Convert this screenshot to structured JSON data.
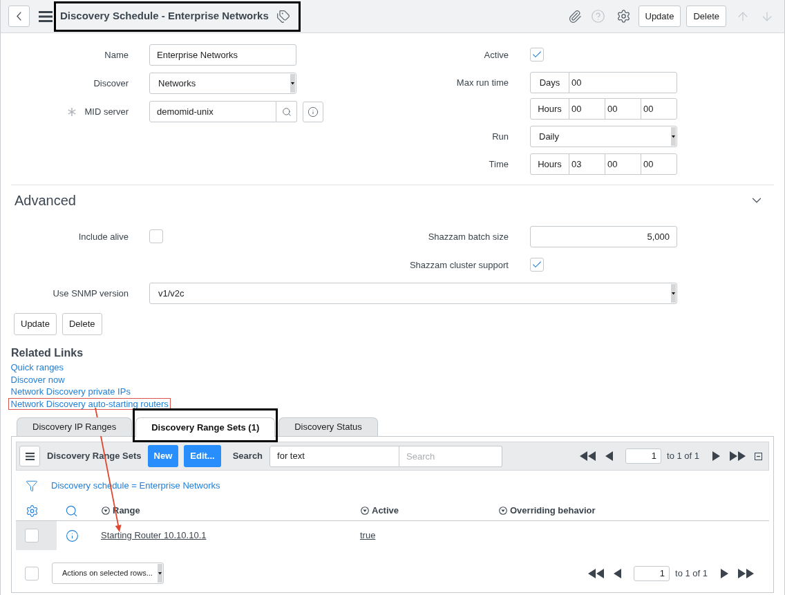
{
  "header": {
    "title": "Discovery Schedule - Enterprise Networks",
    "title_highlighted": true,
    "buttons": [
      "Update",
      "Delete"
    ],
    "nav": [
      {
        "kind": "up",
        "disabled": true
      },
      {
        "kind": "down",
        "disabled": true
      }
    ]
  },
  "form": {
    "left": [
      {
        "kind": "text",
        "label": "Name",
        "value": "Enterprise Networks",
        "required": false
      },
      {
        "kind": "select",
        "label": "Discover",
        "value": "Networks",
        "required": false
      },
      {
        "kind": "reference",
        "label": "MID server",
        "value": "demomid-unix",
        "required": true
      }
    ],
    "right": [
      {
        "kind": "checkbox",
        "label": "Active",
        "checked": true,
        "required": false
      },
      {
        "kind": "duration",
        "label": "Max run time",
        "required": false,
        "rows": [
          {
            "unit": "Days",
            "values": [
              "00"
            ]
          },
          {
            "unit": "Hours",
            "values": [
              "00",
              "00",
              "00"
            ]
          }
        ]
      },
      {
        "kind": "select",
        "label": "Run",
        "value": "Daily",
        "required": false
      },
      {
        "kind": "duration",
        "label": "Time",
        "required": false,
        "rows": [
          {
            "unit": "Hours",
            "values": [
              "03",
              "00",
              "00"
            ]
          }
        ]
      }
    ]
  },
  "advanced": {
    "title": "Advanced",
    "expanded": true,
    "rows": [
      {
        "left": {
          "kind": "checkbox",
          "label": "Include alive",
          "checked": false
        },
        "right": {
          "kind": "number",
          "label": "Shazzam batch size",
          "value": "5,000"
        }
      },
      {
        "right": {
          "kind": "checkbox",
          "label": "Shazzam cluster support",
          "checked": true
        }
      },
      {
        "wide": {
          "kind": "select",
          "label": "Use SNMP version",
          "value": "v1/v2c"
        }
      }
    ]
  },
  "form_buttons": [
    "Update",
    "Delete"
  ],
  "related_links": {
    "title": "Related Links",
    "links": [
      {
        "label": "Quick ranges",
        "highlighted": false
      },
      {
        "label": "Discover now",
        "highlighted": false
      },
      {
        "label": "Network Discovery private IPs",
        "highlighted": false
      },
      {
        "label": "Network Discovery auto-starting routers",
        "highlighted": true
      }
    ]
  },
  "related_lists": {
    "tabs": [
      {
        "label": "Discovery IP Ranges",
        "selected": false,
        "highlighted": false
      },
      {
        "label": "Discovery Range Sets (1)",
        "selected": true,
        "highlighted": true
      },
      {
        "label": "Discovery Status",
        "selected": false,
        "highlighted": false
      }
    ],
    "list": {
      "title": "Discovery Range Sets",
      "buttons": [
        "New",
        "Edit..."
      ],
      "search_label": "Search",
      "search_field": {
        "value": "for text"
      },
      "search_input": {
        "placeholder": "Search"
      },
      "pagination": {
        "page": "1",
        "label": "to 1 of 1"
      },
      "filter": "Discovery schedule = Enterprise Networks",
      "columns": [
        "Range",
        "Active",
        "Overriding behavior"
      ],
      "rows": [
        {
          "checked": false,
          "pointed_at": true,
          "cells": [
            "Starting Router 10.10.10.1",
            "true"
          ]
        }
      ],
      "footer": {
        "select_all_checked": false,
        "actions": "Actions on selected rows...",
        "pagination": {
          "page": "1",
          "label": "to 1 of 1"
        }
      }
    }
  }
}
